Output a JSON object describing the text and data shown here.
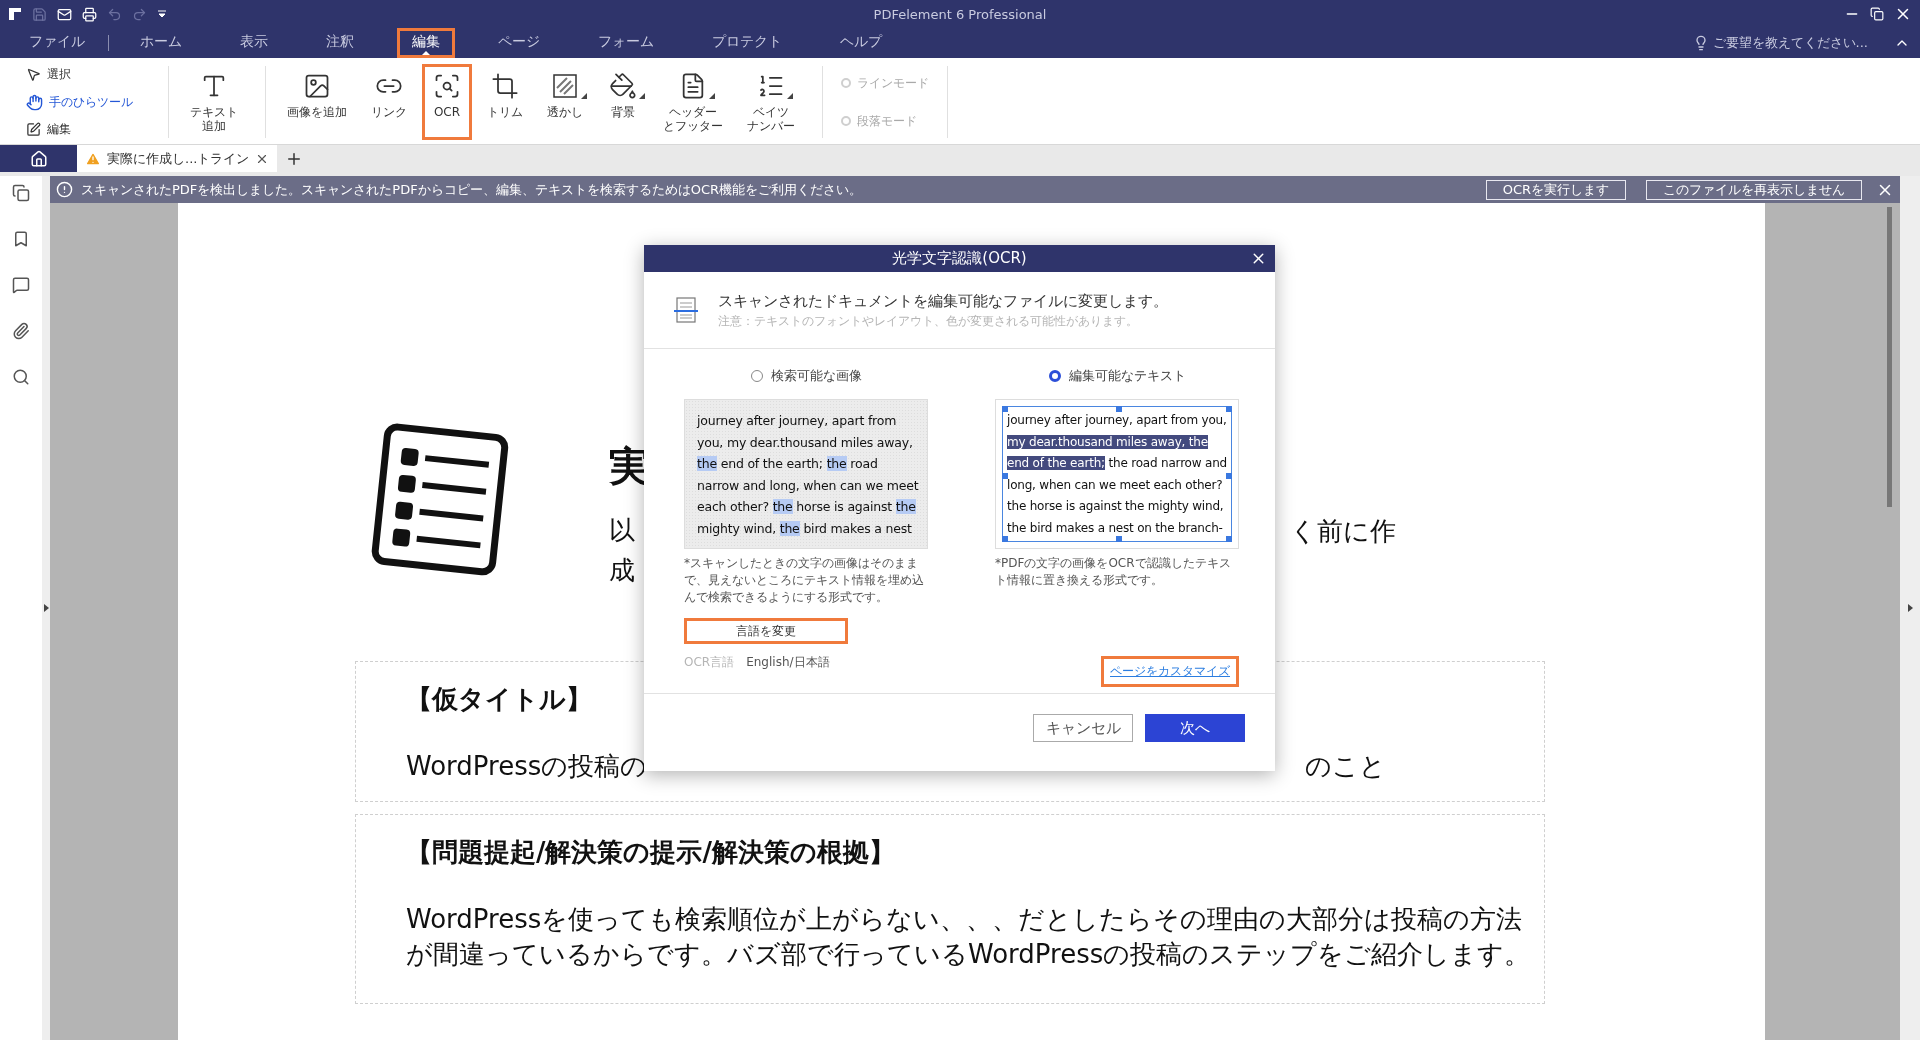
{
  "window": {
    "title": "PDFelement 6 Professional"
  },
  "quick_access": [
    {
      "kind": "save",
      "disabled": true
    },
    {
      "kind": "mail",
      "disabled": false
    },
    {
      "kind": "print",
      "disabled": false
    },
    {
      "kind": "undo",
      "disabled": true
    },
    {
      "kind": "redo",
      "disabled": true
    }
  ],
  "menu": {
    "items": [
      {
        "label": "ファイル",
        "selected": false,
        "highlighted": false
      },
      {
        "label": "ホーム",
        "selected": false,
        "highlighted": false
      },
      {
        "label": "表示",
        "selected": false,
        "highlighted": false
      },
      {
        "label": "注釈",
        "selected": false,
        "highlighted": false
      },
      {
        "label": "編集",
        "selected": true,
        "highlighted": true
      },
      {
        "label": "ページ",
        "selected": false,
        "highlighted": false
      },
      {
        "label": "フォーム",
        "selected": false,
        "highlighted": false
      },
      {
        "label": "プロテクト",
        "selected": false,
        "highlighted": false
      },
      {
        "label": "ヘルプ",
        "selected": false,
        "highlighted": false
      }
    ],
    "feedback": "ご要望を教えてください..."
  },
  "ribbon": {
    "tools": [
      {
        "kind": "select",
        "label": "選択",
        "selected": false
      },
      {
        "kind": "hand",
        "label": "手のひらツール",
        "selected": true
      },
      {
        "kind": "edit",
        "label": "編集",
        "selected": false
      }
    ],
    "buttons": [
      {
        "kind": "text",
        "label_lines": [
          "テキスト",
          "追加"
        ],
        "dropdown": false,
        "highlighted": false
      },
      {
        "kind": "image",
        "label_lines": [
          "画像を追加"
        ],
        "dropdown": false,
        "highlighted": false
      },
      {
        "kind": "link",
        "label_lines": [
          "リンク"
        ],
        "dropdown": false,
        "highlighted": false
      },
      {
        "kind": "ocr",
        "label_lines": [
          "OCR"
        ],
        "dropdown": false,
        "highlighted": true
      },
      {
        "kind": "trim",
        "label_lines": [
          "トリム"
        ],
        "dropdown": false,
        "highlighted": false
      },
      {
        "kind": "watermark",
        "label_lines": [
          "透かし"
        ],
        "dropdown": true,
        "highlighted": false
      },
      {
        "kind": "background",
        "label_lines": [
          "背景"
        ],
        "dropdown": true,
        "highlighted": false
      },
      {
        "kind": "header",
        "label_lines": [
          "ヘッダー",
          "とフッター"
        ],
        "dropdown": true,
        "highlighted": false
      },
      {
        "kind": "bates",
        "label_lines": [
          "ベイツ",
          "ナンバー"
        ],
        "dropdown": true,
        "highlighted": false
      }
    ],
    "modes": [
      {
        "label": "ラインモード",
        "disabled": true
      },
      {
        "label": "段落モード",
        "disabled": true
      }
    ]
  },
  "tabs": [
    {
      "label": "実際に作成し...トライン",
      "warning": true,
      "selected": true
    }
  ],
  "notice": {
    "message": "スキャンされたPDFを検出しました。スキャンされたPDFからコピー、編集、テキストを検索するためはOCR機能をご利用ください。",
    "buttons": [
      "OCRを実行します",
      "このファイルを再表示しません"
    ]
  },
  "document": {
    "heading": "実",
    "intro_lines": [
      "以",
      "成"
    ],
    "intro_right": "く前に作",
    "sections": [
      {
        "title": "【仮タイトル】",
        "lines": [
          "WordPressの投稿の"
        ],
        "body_right": "のこと"
      },
      {
        "title": "【問題提起/解決策の提示/解決策の根拠】",
        "lines": [
          "WordPressを使っても検索順位が上がらない、、、だとしたらその理由の大部分は投稿の方法",
          "が間違っているからです。バズ部で行っているWordPressの投稿のステップをご紹介します。"
        ]
      }
    ]
  },
  "dialog": {
    "title": "光学文字認識(OCR)",
    "heading": "スキャンされたドキュメントを編集可能なファイルに変更します。",
    "note": "注意：テキストのフォントやレイアウト、色が変更される可能性があります。",
    "options": [
      {
        "kind": "image",
        "label": "検索可能な画像",
        "selected": false,
        "preview_lines": [
          [
            {
              "text": "journey after journey, apart from",
              "highlighted": false
            }
          ],
          [
            {
              "text": "you, my dear.thousand miles away,",
              "highlighted": false
            }
          ],
          [
            {
              "text": "the",
              "highlighted": true
            },
            {
              "text": " end of the earth; ",
              "highlighted": false
            },
            {
              "text": "the",
              "highlighted": true
            },
            {
              "text": " road",
              "highlighted": false
            }
          ],
          [
            {
              "text": "narrow and long, when can we meet",
              "highlighted": false
            }
          ],
          [
            {
              "text": "each other? ",
              "highlighted": false
            },
            {
              "text": "the",
              "highlighted": true
            },
            {
              "text": " horse is against ",
              "highlighted": false
            },
            {
              "text": "the",
              "highlighted": true
            }
          ],
          [
            {
              "text": "mighty wind, ",
              "highlighted": false
            },
            {
              "text": "the",
              "highlighted": true
            },
            {
              "text": " bird makes a nest",
              "highlighted": false
            }
          ]
        ],
        "caption": "*スキャンしたときの文字の画像はそのままで、見えないところにテキスト情報を埋め込んで検索できるようにする形式です。"
      },
      {
        "kind": "text",
        "label": "編集可能なテキスト",
        "selected": true,
        "preview_lines": [
          [
            {
              "text": "journey after journey, apart from you,",
              "highlighted": false
            }
          ],
          [
            {
              "text": "my dear.thousand miles away, the ",
              "highlighted": true
            }
          ],
          [
            {
              "text": "end of the earth;",
              "highlighted": true
            },
            {
              "text": " the road narrow and",
              "highlighted": false
            }
          ],
          [
            {
              "text": "long, when can we meet each other?",
              "highlighted": false
            }
          ],
          [
            {
              "text": "the horse is against the mighty wind,",
              "highlighted": false
            }
          ],
          [
            {
              "text": "the bird makes a nest on the branch-",
              "highlighted": false
            }
          ]
        ],
        "caption": "*PDFの文字の画像をOCRで認識したテキスト情報に置き換える形式です。"
      }
    ],
    "language_button": {
      "label": "言語を変更",
      "highlighted": true
    },
    "language_label": "OCR言語",
    "language_value": "English/日本語",
    "customize_link": {
      "label": "ページをカスタマイズ",
      "highlighted": true
    },
    "buttons": [
      {
        "kind": "secondary",
        "label": "キャンセル"
      },
      {
        "kind": "primary",
        "label": "次へ"
      }
    ]
  }
}
